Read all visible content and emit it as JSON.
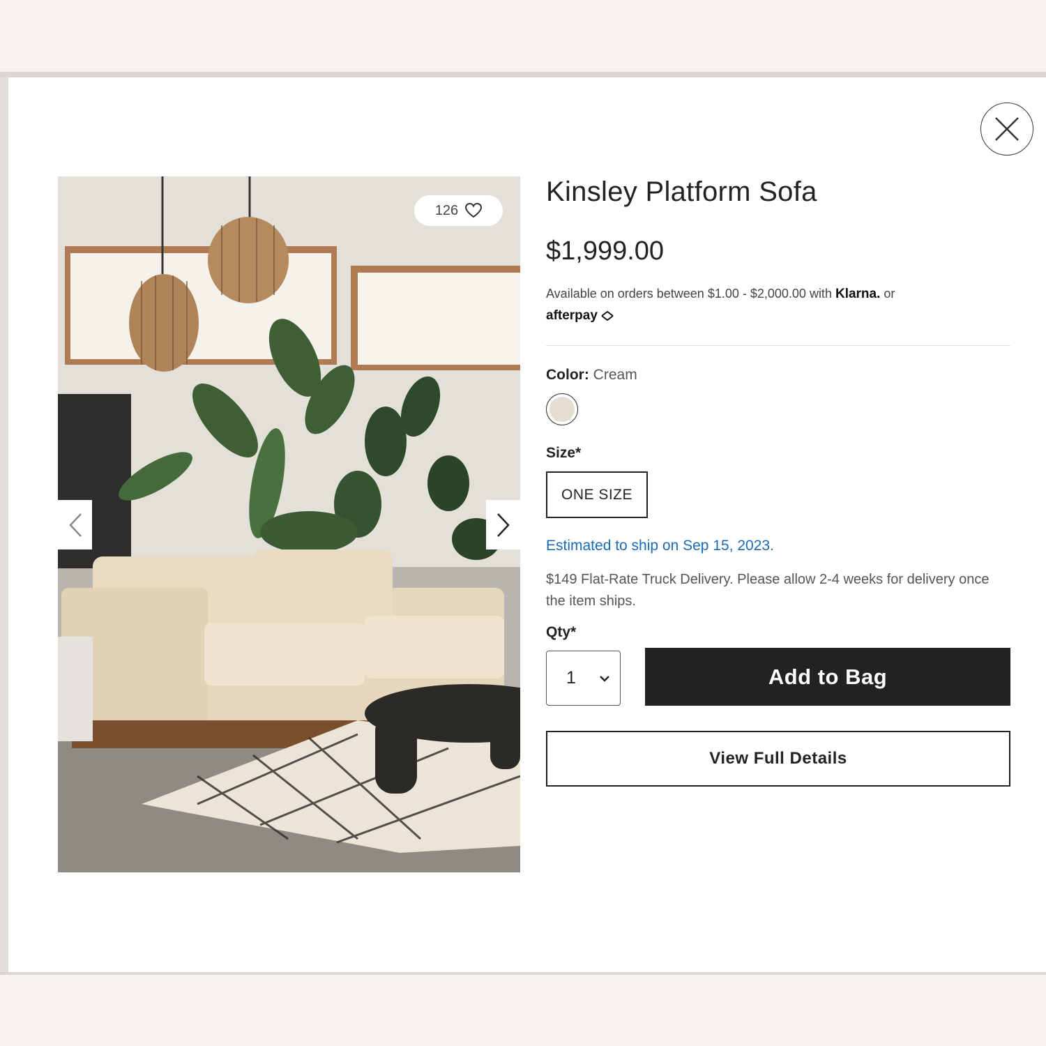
{
  "product": {
    "title": "Kinsley Platform Sofa",
    "price": "$1,999.00",
    "likes": "126"
  },
  "payment": {
    "text": "Available on orders between $1.00 - $2,000.00 with",
    "klarna": "Klarna.",
    "or": "or",
    "afterpay": "afterpay"
  },
  "color": {
    "label": "Color:",
    "value": "Cream",
    "swatch": "#e4ded2"
  },
  "size": {
    "label": "Size*",
    "option": "ONE SIZE"
  },
  "shipping": {
    "estimate": "Estimated to ship on Sep 15, 2023.",
    "delivery": "$149 Flat-Rate Truck Delivery. Please allow 2-4 weeks for delivery once the item ships."
  },
  "quantity": {
    "label": "Qty*",
    "value": "1"
  },
  "actions": {
    "add_to_bag": "Add to Bag",
    "view_details": "View Full Details"
  },
  "icons": {
    "close": "close-icon",
    "heart": "heart-icon",
    "prev": "chevron-left-icon",
    "next": "chevron-right-icon",
    "dropdown": "chevron-down-icon"
  },
  "colors": {
    "accent_link": "#1a6ab5",
    "button_dark": "#222222"
  }
}
